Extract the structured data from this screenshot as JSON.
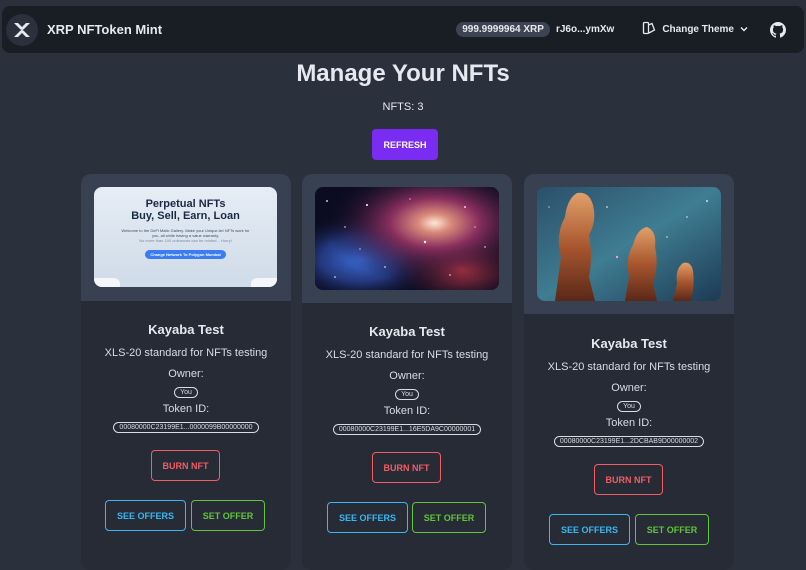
{
  "navbar": {
    "app_title": "XRP NFToken Mint",
    "balance": "999.9999964 XRP",
    "address": "rJ6o...ymXw",
    "theme_label": "Change Theme"
  },
  "header": {
    "title": "Manage Your NFTs",
    "count_label": "NFTS:",
    "count_value": "3",
    "refresh_label": "REFRESH"
  },
  "cards": [
    {
      "title": "Kayaba Test",
      "description": "XLS-20 standard for NFTs testing",
      "owner_label": "Owner:",
      "owner": "You",
      "token_label": "Token ID:",
      "token_id": "00080000C23199E1...0000099B00000000",
      "burn_label": "BURN NFT",
      "offers_label": "SEE OFFERS",
      "set_offer_label": "SET OFFER",
      "image": {
        "heading_line1": "Perpetual NFTs",
        "heading_line2": "Buy, Sell, Earn, Loan",
        "text_line1": "Welcome to the DeFi Matic Gallery. Make your Unique Art NFTs work for",
        "text_line2": "you, all while having a value warranty.",
        "text_line3": "No more than 100 onlineusts can be minted... Hurry!",
        "button": "Change Network To Polygon Mumbai"
      }
    },
    {
      "title": "Kayaba Test",
      "description": "XLS-20 standard for NFTs testing",
      "owner_label": "Owner:",
      "owner": "You",
      "token_label": "Token ID:",
      "token_id": "00080000C23199E1...16E5DA9C00000001",
      "burn_label": "BURN NFT",
      "offers_label": "SEE OFFERS",
      "set_offer_label": "SET OFFER"
    },
    {
      "title": "Kayaba Test",
      "description": "XLS-20 standard for NFTs testing",
      "owner_label": "Owner:",
      "owner": "You",
      "token_label": "Token ID:",
      "token_id": "00080000C23199E1...2DCBAB9D00000002",
      "burn_label": "BURN NFT",
      "offers_label": "SEE OFFERS",
      "set_offer_label": "SET OFFER"
    }
  ],
  "colors": {
    "background": "#2a303c",
    "navbar": "#191d24",
    "primary": "#7a2cf2",
    "error": "#f25c65",
    "info": "#3ab7f0",
    "success": "#61c43a"
  },
  "icons": [
    "xrp-logo-icon",
    "theme-icon",
    "chevron-down-icon",
    "github-icon"
  ]
}
